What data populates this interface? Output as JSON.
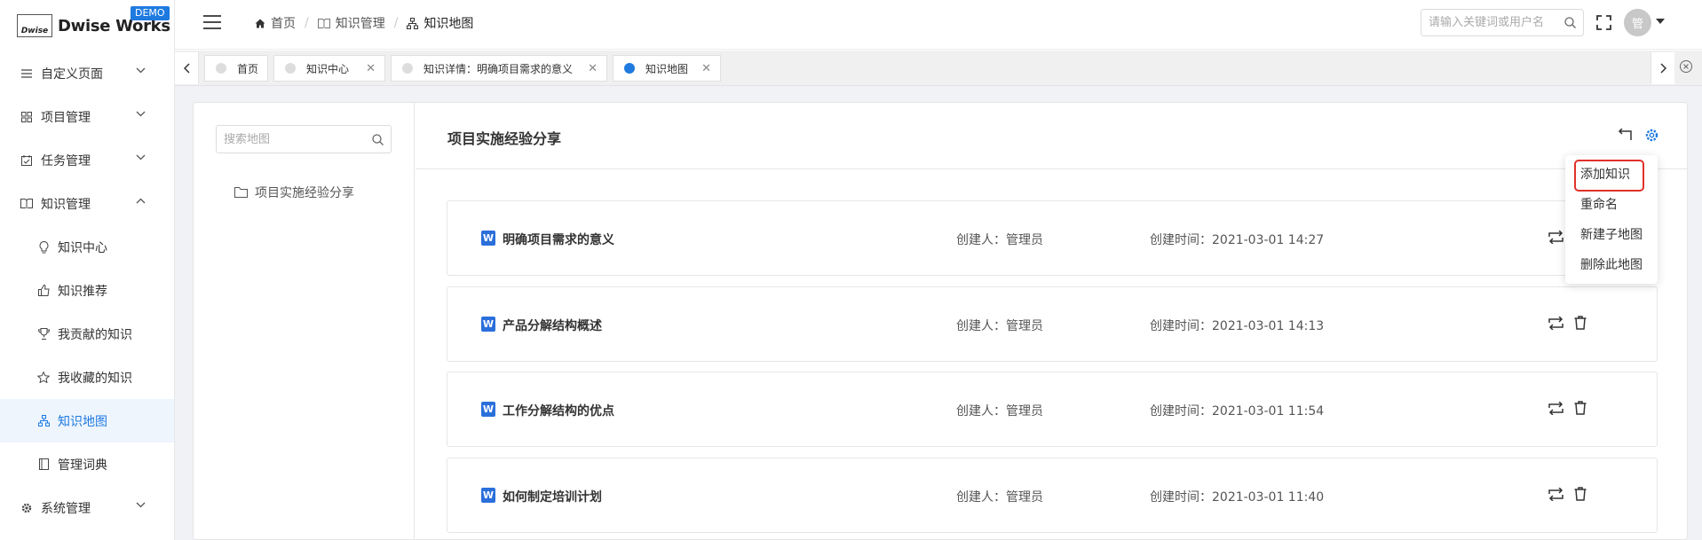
{
  "app": {
    "logo_mark": "Dwise",
    "logo_text": "Dwise Works",
    "badge": "DEMO"
  },
  "sidebar": {
    "items": [
      {
        "label": "自定义页面",
        "icon": "list-icon",
        "expanded": false
      },
      {
        "label": "项目管理",
        "icon": "grid-icon",
        "expanded": false
      },
      {
        "label": "任务管理",
        "icon": "calendar-check-icon",
        "expanded": false
      },
      {
        "label": "知识管理",
        "icon": "book-icon",
        "expanded": true
      },
      {
        "label": "系统管理",
        "icon": "gear-icon",
        "expanded": false
      }
    ],
    "knowledge_sub": [
      {
        "label": "知识中心",
        "icon": "bulb-icon"
      },
      {
        "label": "知识推荐",
        "icon": "thumb-up-icon"
      },
      {
        "label": "我贡献的知识",
        "icon": "trophy-icon"
      },
      {
        "label": "我收藏的知识",
        "icon": "star-icon"
      },
      {
        "label": "知识地图",
        "icon": "sitemap-icon",
        "active": true
      },
      {
        "label": "管理词典",
        "icon": "dictionary-icon"
      }
    ]
  },
  "header": {
    "breadcrumb": [
      {
        "label": "首页",
        "icon": "home-icon"
      },
      {
        "label": "知识管理",
        "icon": "book-icon"
      },
      {
        "label": "知识地图",
        "icon": "sitemap-icon"
      }
    ],
    "search_placeholder": "请输入关键词或用户名",
    "avatar": "管"
  },
  "tabs": [
    {
      "label": "首页",
      "closable": false,
      "active": false
    },
    {
      "label": "知识中心",
      "closable": true,
      "active": false
    },
    {
      "label": "知识详情：明确项目需求的意义",
      "closable": true,
      "active": false
    },
    {
      "label": "知识地图",
      "closable": true,
      "active": true
    }
  ],
  "left_pane": {
    "search_placeholder": "搜索地图",
    "tree_root": "项目实施经验分享"
  },
  "right_pane": {
    "title": "项目实施经验分享",
    "rows": [
      {
        "title": "明确项目需求的意义",
        "creator": "创建人：管理员",
        "time": "创建时间：2021-03-01 14:27"
      },
      {
        "title": "产品分解结构概述",
        "creator": "创建人：管理员",
        "time": "创建时间：2021-03-01 14:13"
      },
      {
        "title": "工作分解结构的优点",
        "creator": "创建人：管理员",
        "time": "创建时间：2021-03-01 11:54"
      },
      {
        "title": "如何制定培训计划",
        "creator": "创建人：管理员",
        "time": "创建时间：2021-03-01 11:40"
      }
    ]
  },
  "dropdown": {
    "items": [
      "添加知识",
      "重命名",
      "新建子地图",
      "删除此地图"
    ]
  },
  "colors": {
    "accent": "#1f7ae0",
    "word_icon": "#2b6fdb",
    "highlight_border": "#e0302a"
  }
}
